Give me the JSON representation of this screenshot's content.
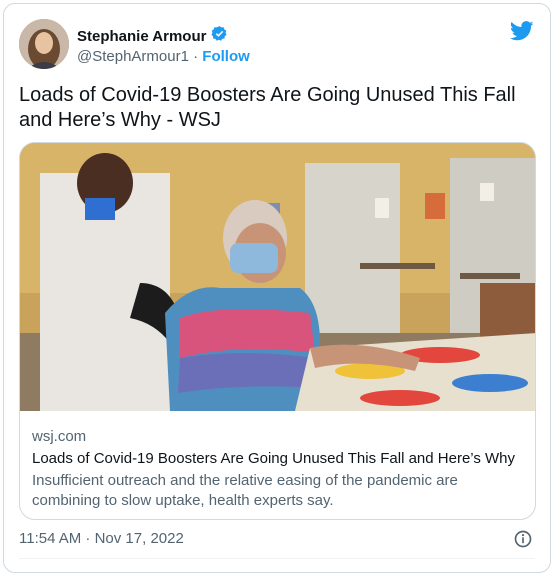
{
  "author": {
    "name": "Stephanie Armour",
    "handle": "@StephArmour1",
    "separator": "·",
    "follow_label": "Follow",
    "verified": true
  },
  "tweet_text": "Loads of Covid-19 Boosters Are Going Unused This Fall and Here’s Why - WSJ",
  "card": {
    "domain": "wsj.com",
    "title": "Loads of Covid-19 Boosters Are Going Unused This Fall and Here’s Why",
    "description": "Insufficient outreach and the relative easing of the pandemic are combining to slow uptake, health experts say."
  },
  "timestamp": "11:54 AM · Nov 17, 2022",
  "colors": {
    "accent": "#1d9bf0",
    "muted": "#536471",
    "text": "#0f1419"
  },
  "icons": {
    "platform": "twitter-bird-icon",
    "verified": "verified-badge-icon",
    "info": "info-icon"
  }
}
